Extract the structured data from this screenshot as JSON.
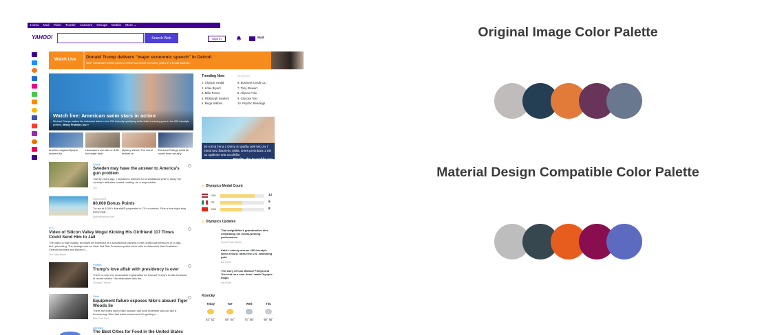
{
  "screenshot": {
    "topnav": [
      "Home",
      "Mail",
      "Flickr",
      "Tumblr",
      "Answers",
      "Groups",
      "Mobile",
      "More ⌄"
    ],
    "logo": "YAHOO!",
    "search_button": "Search Web",
    "sign_in": "Sign in",
    "mail": "Mail",
    "banner": {
      "live": "Watch Live",
      "headline": "Donald Trump delivers \"major economic speech\" in Detroit",
      "sub": "GOP candidate reveals plans to revive and boost economic policy in a broad address"
    },
    "hero": {
      "title": "Watch live: American swim stars in action",
      "desc": "Michael Phelps makes his individual debut in the 200 butterfly qualifying while Katie Ledecky goes in the 200 freestyle prelims.",
      "more": "Missy Franklin, too »"
    },
    "thumbs": [
      "Another magical Olympic moment for",
      "Lawmaker's son dies on 186-foot water slide",
      "Mystery solved: The round bruises on",
      "Electoral College could be under more scrutiny"
    ],
    "stories": [
      {
        "category": "World",
        "headline": "Sweden may have the answer to America's gun problem",
        "body": "Twenty years ago, I headed to Sweden for a sabbatical year to study the country's attitudes toward hunting. As a responsible...",
        "source": "Vox"
      },
      {
        "category": "Sponsored",
        "headline": "80,000 Bonus Points",
        "body": "To use at 4,000+ Marriott® properties in 70+ countries. Plus a free night stay every year.",
        "source": "MarriottPartner.com"
      },
      {
        "category": "U.S.",
        "headline": "Video of Silicon Valley Mogul Kicking His Girlfriend 117 Times Could Send Him to Jail",
        "body": "The video is high quality, as might be expected of a surveillance camera in the penthouse bedroom of a high-tech princeling. The footage was so clear that San Francisco police were able to determine that Gurbaksh Chahal punched and kicked h...",
        "source": "The Daily Beast"
      },
      {
        "category": "Politics",
        "headline": "Trump's love affair with presidency is over",
        "body": "There is only one reasonable explanation for Donald Trump's erratic behavior in recent weeks. His infatuation with the...",
        "source": "Chicago Tribune"
      },
      {
        "category": "Style",
        "headline": "Equipment failure exposes Nike's absurd Tiger Woods lie",
        "body": "There are times when Nike swoosh can both resemble and act like a boomerang. Nike last week announced it's getting o...",
        "source": "New York Post"
      },
      {
        "category": "Lifestyle",
        "headline": "The Best Cities for Food in the United States",
        "body": "",
        "source": ""
      }
    ],
    "trending": {
      "title": "Trending Now",
      "other_tab": "Olympics",
      "left": [
        "1. Olympic medal",
        "2. Kobe Bryant",
        "3. Mike Pence",
        "4. Pittsburgh Steelers",
        "5. Mega Millions"
      ],
      "right": [
        "6. Business Credit Ca..",
        "7. Tony Stewart",
        "8. Allyson Felix",
        "9. Glucose Test",
        "10. Psychic Readings"
      ]
    },
    "ad_text": "30-ročná žena z Detvy si opäľila celé telo za 7 minút bez žiadneho úsilia. Dnes prezrádza 1 trik na opálenie tela na dlhšie.",
    "ad_link": "Pozrite, ako to urobila >>>",
    "ad_brand": "QUICK SUN SPRAY",
    "medal_count": {
      "title": "Olympics Medal Count",
      "rows": [
        {
          "country": "USA",
          "count": "12",
          "fill": 0.78
        },
        {
          "country": "ITA",
          "count": "8",
          "fill": 0.5
        },
        {
          "country": "CHN",
          "count": "8",
          "fill": 0.5
        }
      ]
    },
    "updates": {
      "title": "Olympics Updates",
      "items": [
        {
          "text": "Thai weightlifter's grandmother dies celebrating his medal-winning performance",
          "source": "Fourth-Place Medal"
        },
        {
          "text": "Katie Ledecky storms 400 freestyle world record, rates first U.S. swimming gold",
          "source": "Pat Forde"
        },
        {
          "text": "The story of how Michael Phelps and 'the best turn over done' made Olympic magic",
          "source": "Pat Forde"
        }
      ]
    },
    "weather": {
      "city": "Kosicky",
      "days": [
        "Today",
        "Tue",
        "Wed",
        "Thu"
      ],
      "temps": [
        "81° 51°",
        "84° 54°",
        "73° 55°",
        "68° 55°"
      ]
    }
  },
  "palettes": {
    "original_title": "Original Image Color Palette",
    "original_colors": [
      "#c0bcbc",
      "#243e54",
      "#e27a3a",
      "#683459",
      "#69788f"
    ],
    "material_title": "Material Design Compatible Color Palette",
    "material_colors": [
      "#bdbdbd",
      "#37474f",
      "#e65d1d",
      "#880e4f",
      "#5c6bc0"
    ]
  }
}
